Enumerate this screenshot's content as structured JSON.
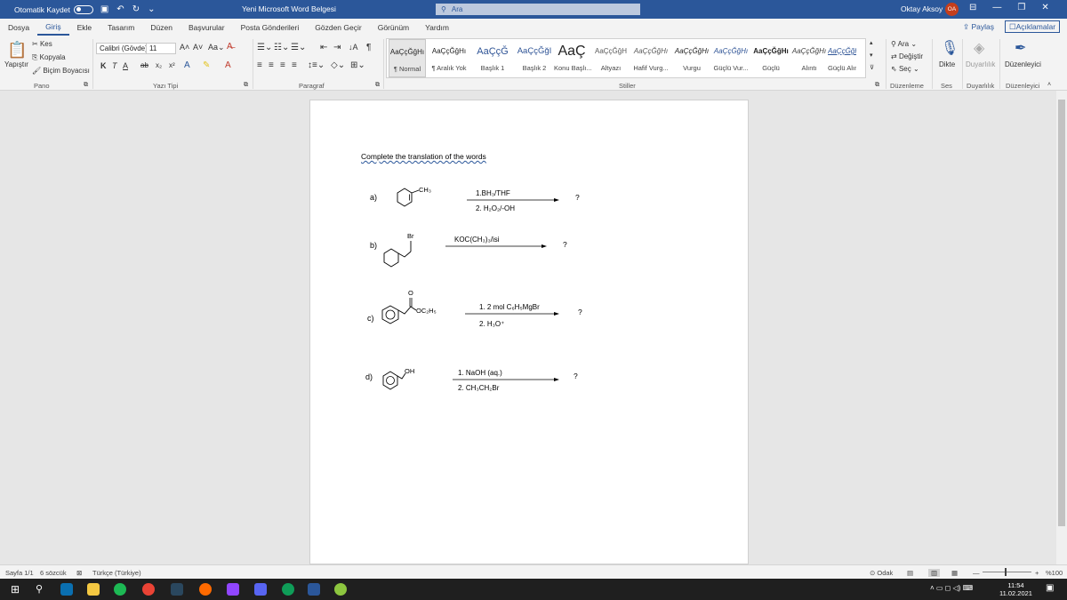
{
  "titlebar": {
    "autosave_label": "Otomatik Kaydet",
    "document_title": "Yeni Microsoft Word Belgesi",
    "search_placeholder": "Ara",
    "user_name": "Oktay Aksoy",
    "user_initials": "OA"
  },
  "tabs": [
    "Dosya",
    "Giriş",
    "Ekle",
    "Tasarım",
    "Düzen",
    "Başvurular",
    "Posta Gönderileri",
    "Gözden Geçir",
    "Görünüm",
    "Yardım"
  ],
  "actions": {
    "share": "Paylaş",
    "comments": "Açıklamalar"
  },
  "ribbon": {
    "clipboard": {
      "paste": "Yapıştır",
      "cut": "Kes",
      "copy": "Kopyala",
      "format_painter": "Biçim Boyacısı",
      "group": "Pano"
    },
    "font": {
      "name": "Calibri (Gövde)",
      "size": "11",
      "group": "Yazı Tipi"
    },
    "paragraph": {
      "group": "Paragraf"
    },
    "styles": {
      "group": "Stiller",
      "items": [
        {
          "sample": "AaÇçĞğHı",
          "name": "¶ Normal"
        },
        {
          "sample": "AaÇçĞğHı",
          "name": "¶ Aralık Yok"
        },
        {
          "sample": "AaÇçĞ",
          "name": "Başlık 1"
        },
        {
          "sample": "AaÇçĞğI",
          "name": "Başlık 2"
        },
        {
          "sample": "AaÇ",
          "name": "Konu Başlı..."
        },
        {
          "sample": "AaÇçĞğH",
          "name": "Altyazı"
        },
        {
          "sample": "AaÇçĞğHı",
          "name": "Hafif Vurg..."
        },
        {
          "sample": "AaÇçĞğHı",
          "name": "Vurgu"
        },
        {
          "sample": "AaÇçĞğHı",
          "name": "Güçlü Vur..."
        },
        {
          "sample": "AaÇçĞğHı",
          "name": "Güçlü"
        },
        {
          "sample": "AaÇçĞğHı",
          "name": "Alıntı"
        },
        {
          "sample": "AaÇçĞğHı",
          "name": "Güçlü Alıntı"
        }
      ]
    },
    "editing": {
      "find": "Ara",
      "replace": "Değiştir",
      "select": "Seç",
      "group": "Düzenleme"
    },
    "voice": {
      "dictate": "Dikte",
      "group": "Ses"
    },
    "sensitivity": {
      "label": "Duyarlılık",
      "group": "Duyarlılık"
    },
    "editor": {
      "label": "Düzenleyici",
      "group": "Düzenleyici"
    }
  },
  "document": {
    "instruction": "Complete the translation of the words",
    "reactions": [
      {
        "label": "a)",
        "substituent": "CH₃",
        "reagent_top": "1.BH₃/THF",
        "reagent_bottom": "2. H₂O₂/-OH",
        "product": "?"
      },
      {
        "label": "b)",
        "substituent": "Br",
        "reagent_top": "KOC(CH₃)₃/isi",
        "reagent_bottom": "",
        "product": "?"
      },
      {
        "label": "c)",
        "substituent_top": "O",
        "substituent": "OC₂H₅",
        "reagent_top": "1. 2 mol C₆H₅MgBr",
        "reagent_bottom": "2. H₃O⁺",
        "product": "?"
      },
      {
        "label": "d)",
        "substituent": "OH",
        "reagent_top": "1. NaOH (aq.)",
        "reagent_bottom": "2. CH₃CH₂Br",
        "product": "?"
      }
    ]
  },
  "statusbar": {
    "page": "Sayfa 1/1",
    "words": "6 sözcük",
    "language": "Türkçe (Türkiye)",
    "focus": "Odak",
    "zoom": "%100"
  },
  "taskbar": {
    "time": "11:54",
    "date": "11.02.2021"
  }
}
